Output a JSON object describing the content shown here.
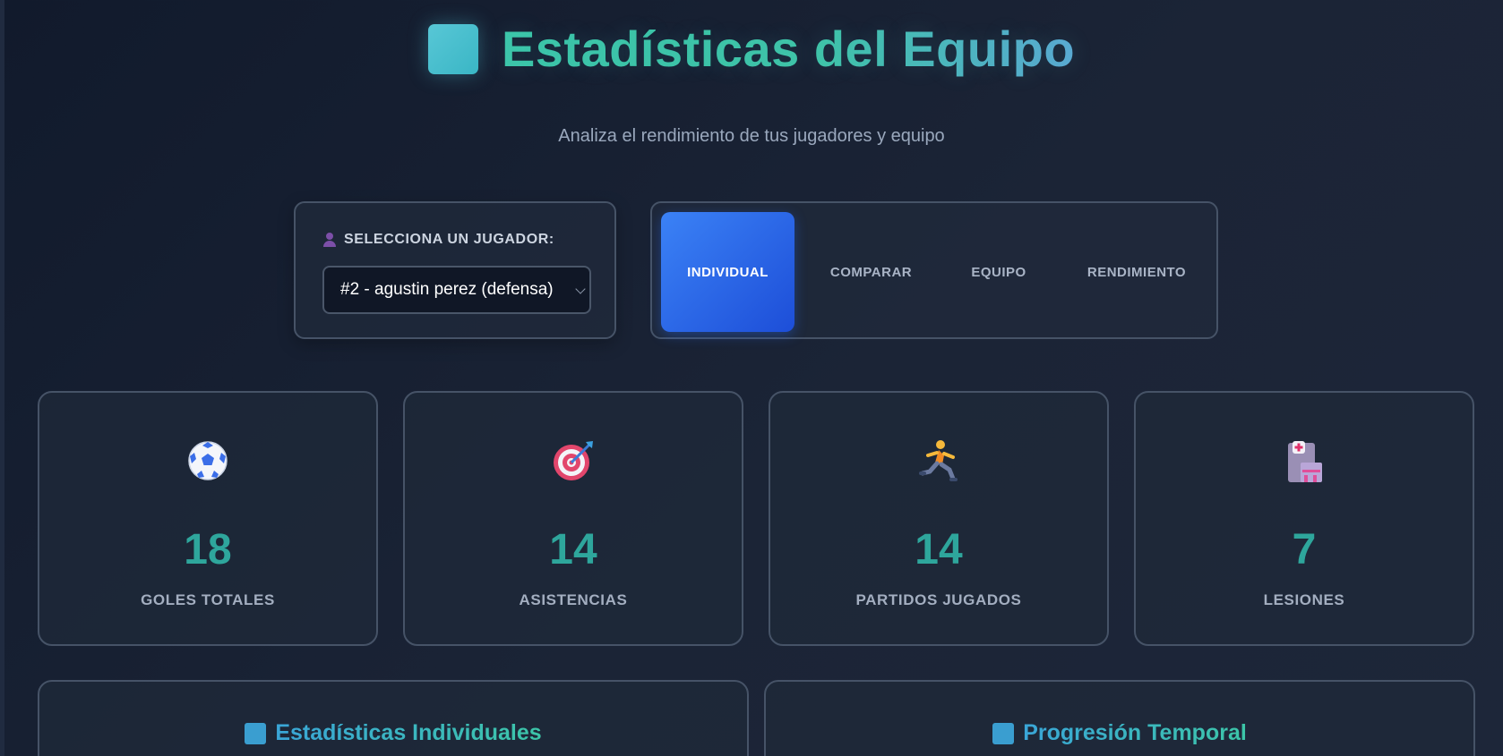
{
  "header": {
    "title": "Estadísticas del Equipo",
    "subtitle": "Analiza el rendimiento de tus jugadores y equipo"
  },
  "player_selector": {
    "label": "SELECCIONA UN JUGADOR:",
    "icon": "person-icon",
    "selected_value": "#2 - agustin perez (defensa)"
  },
  "tabs": [
    {
      "label": "INDIVIDUAL",
      "active": true
    },
    {
      "label": "COMPARAR",
      "active": false
    },
    {
      "label": "EQUIPO",
      "active": false
    },
    {
      "label": "RENDIMIENTO",
      "active": false
    }
  ],
  "stats": [
    {
      "icon": "soccer-ball-icon",
      "value": "18",
      "label": "GOLES TOTALES"
    },
    {
      "icon": "target-icon",
      "value": "14",
      "label": "ASISTENCIAS"
    },
    {
      "icon": "runner-icon",
      "value": "14",
      "label": "PARTIDOS JUGADOS"
    },
    {
      "icon": "hospital-icon",
      "value": "7",
      "label": "LESIONES"
    }
  ],
  "panels": [
    {
      "title": "Estadísticas Individuales",
      "icon": "chart-square-icon"
    },
    {
      "title": "Progresión Temporal",
      "icon": "chart-square-icon"
    }
  ],
  "colors": {
    "accent_teal": "#2ea69c",
    "tab_active_blue": "#2563eb",
    "card_border": "#465367",
    "background": "#161f31"
  }
}
